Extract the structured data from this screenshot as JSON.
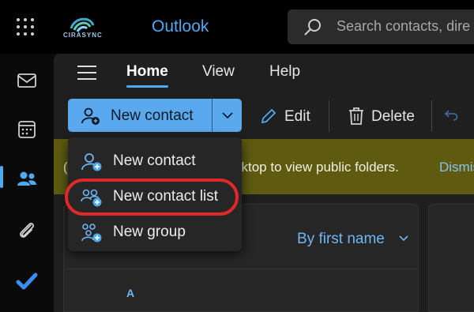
{
  "app": {
    "title": "Outlook",
    "logo_text": "CIRASYNC"
  },
  "search": {
    "placeholder": "Search contacts, dire"
  },
  "tabs": [
    {
      "label": "Home",
      "active": true
    },
    {
      "label": "View"
    },
    {
      "label": "Help"
    }
  ],
  "ribbon": {
    "new_contact": "New contact",
    "edit": "Edit",
    "delete": "Delete"
  },
  "dropdown": {
    "items": [
      {
        "label": "New contact",
        "icon": "person-add-icon"
      },
      {
        "label": "New contact list",
        "icon": "people-list-add-icon",
        "highlighted": true
      },
      {
        "label": "New group",
        "icon": "group-add-icon"
      }
    ]
  },
  "banner": {
    "lead": "(",
    "text": "sktop to view public folders.",
    "link": "Dismis"
  },
  "list": {
    "sort_label": "By first name",
    "section_letter": "A"
  },
  "colors": {
    "accent": "#4fa8f0",
    "button": "#5aa8ee",
    "banner": "#5e5b10",
    "highlight": "#e0282a"
  }
}
